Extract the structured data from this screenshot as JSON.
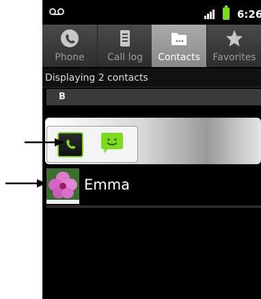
{
  "status_bar": {
    "time": "6:26"
  },
  "tabs": [
    {
      "label": "Phone",
      "icon": "phone-icon"
    },
    {
      "label": "Call log",
      "icon": "call-log-icon"
    },
    {
      "label": "Contacts",
      "icon": "contacts-icon",
      "selected": true
    },
    {
      "label": "Favorites",
      "icon": "star-icon"
    }
  ],
  "list": {
    "info": "Displaying 2 contacts",
    "section_letter": "B",
    "contact_name": "Emma"
  },
  "quick_contact": {
    "call_icon": "phone-icon",
    "message_icon": "message-icon"
  },
  "colors": {
    "accent_green": "#7ddb1d",
    "selected_tab": "#9c9c9c"
  }
}
